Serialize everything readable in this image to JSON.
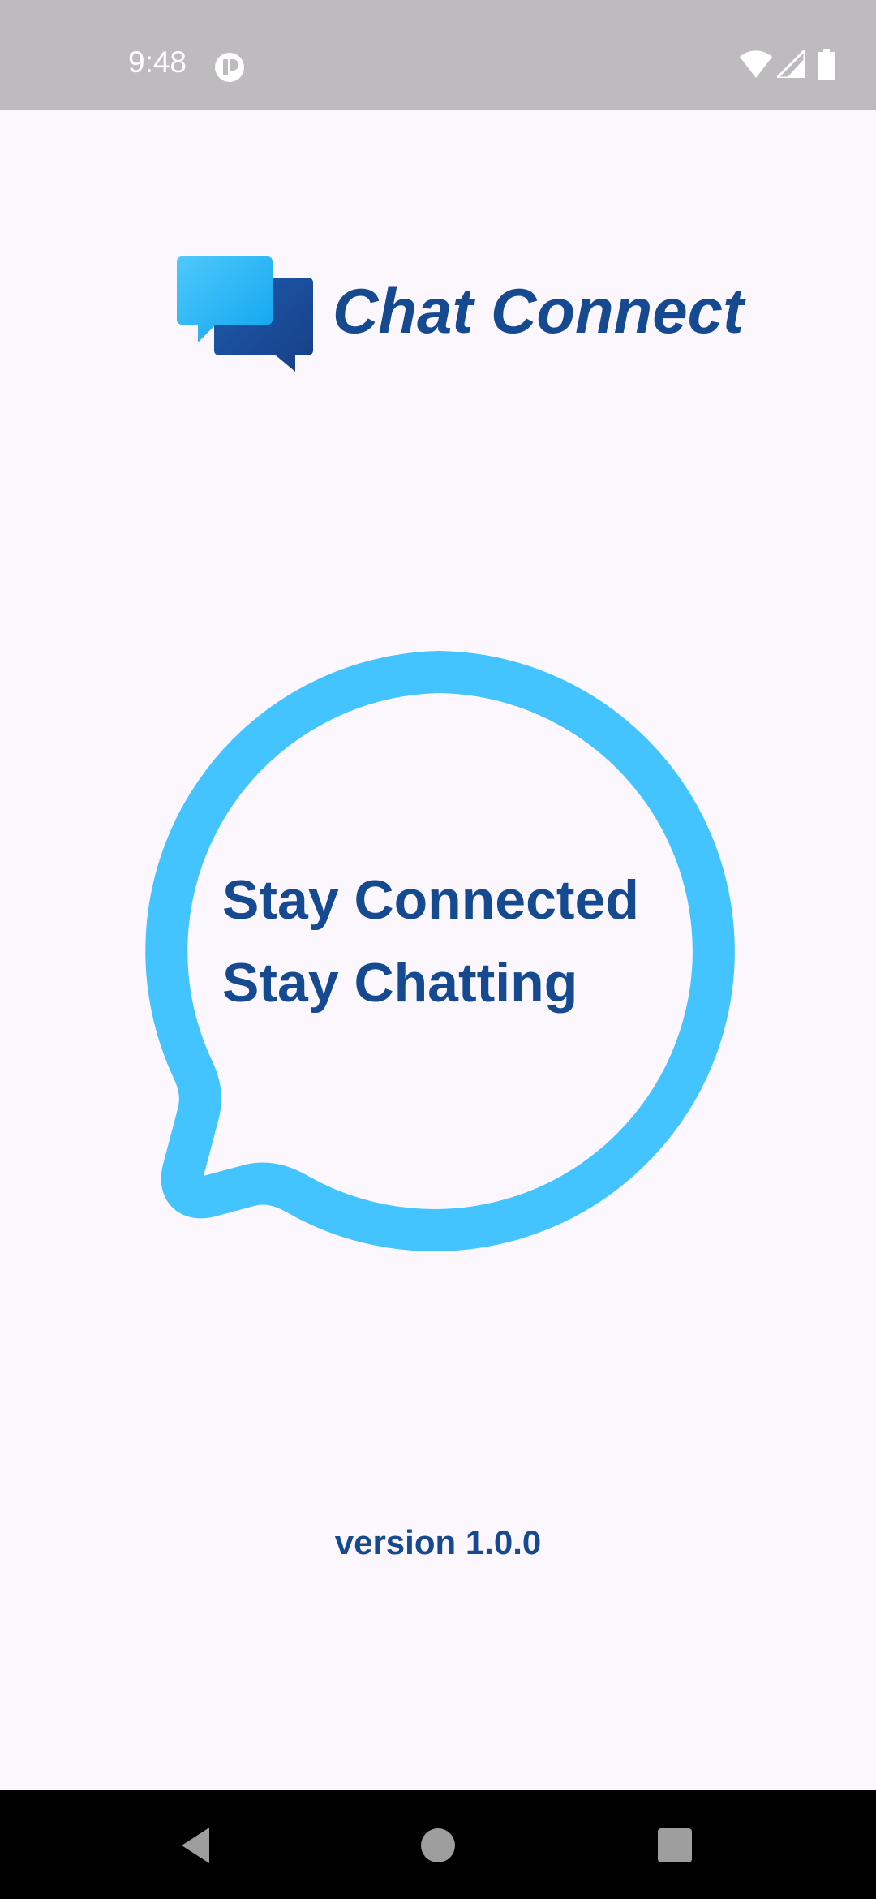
{
  "status_bar": {
    "time": "9:48",
    "icons": [
      "app-notification-icon",
      "wifi-icon",
      "cellular-signal-icon",
      "battery-icon"
    ]
  },
  "brand": {
    "app_name": "Chat Connect",
    "logo_icon": "chat-bubbles-logo-icon"
  },
  "hero": {
    "line1": "Stay Connected",
    "line2": "Stay Chatting",
    "bubble_icon": "speech-bubble-outline-icon"
  },
  "footer": {
    "version": "version 1.0.0"
  },
  "nav_bar": {
    "buttons": [
      "back-icon",
      "home-icon",
      "recents-icon"
    ]
  },
  "colors": {
    "background": "#FCF7FD",
    "status_bar": "#BEBBBF",
    "brand_text": "#154A91",
    "bubble_stroke": "#44C4FF",
    "logo_light": "#29B6F6",
    "logo_dark": "#1A4C98"
  }
}
